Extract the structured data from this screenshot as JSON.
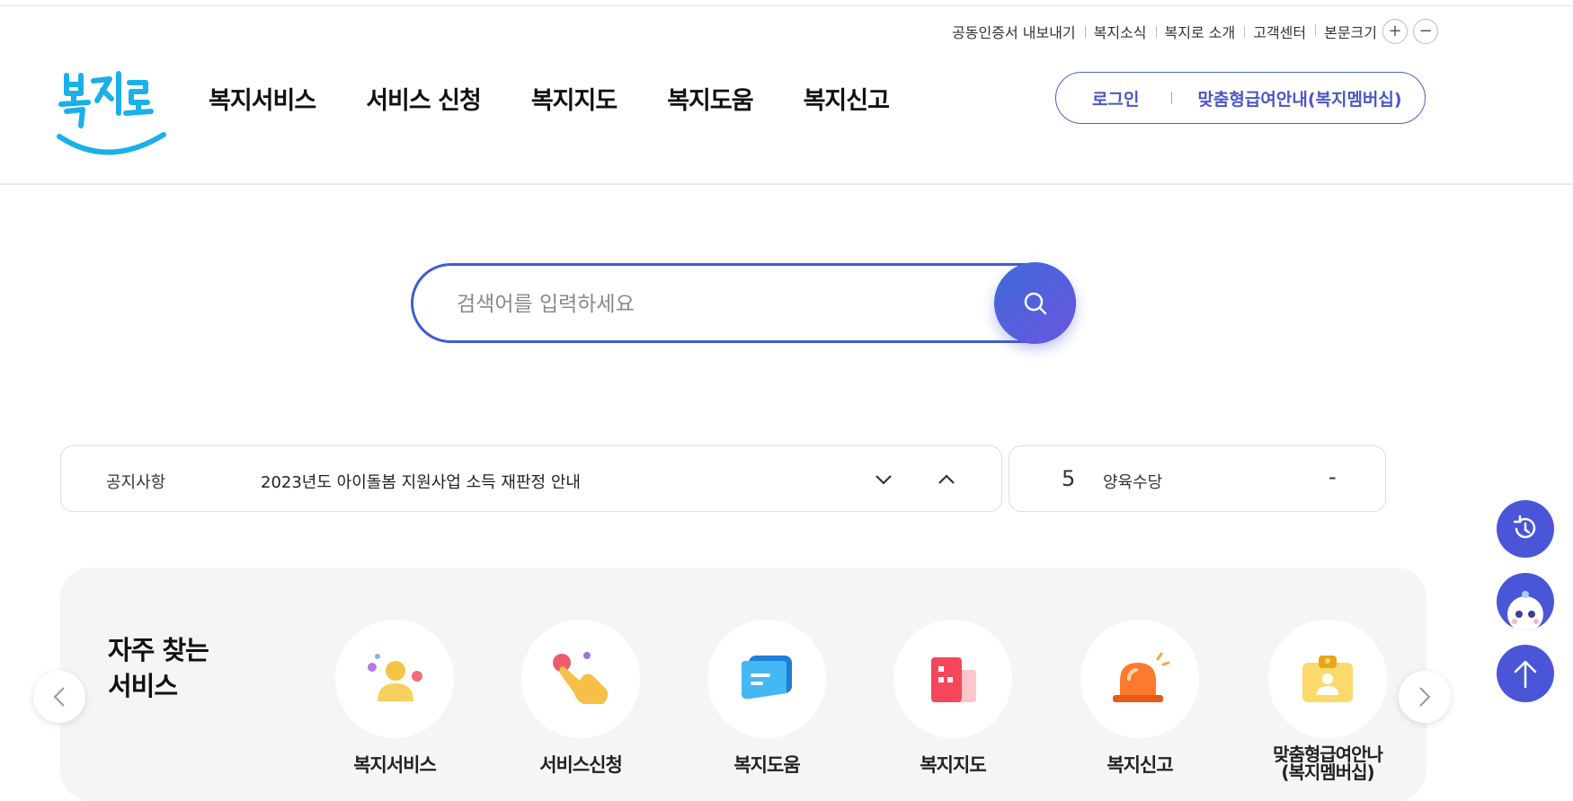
{
  "util_links": [
    "공동인증서 내보내기",
    "복지소식",
    "복지로 소개",
    "고객센터"
  ],
  "text_size": {
    "label": "본문크기",
    "plus": "+",
    "minus": "−"
  },
  "logo": {
    "text": "복지로"
  },
  "gnb": [
    "복지서비스",
    "서비스 신청",
    "복지지도",
    "복지도움",
    "복지신고"
  ],
  "login": {
    "login_label": "로그인",
    "membership_label": "맞춤형급여안내(복지멤버십)"
  },
  "search": {
    "placeholder": "검색어를 입력하세요"
  },
  "notice": {
    "label": "공지사항",
    "text": "2023년도 아이돌봄 지원사업 소득 재판정 안내"
  },
  "ranking": {
    "rank": "5",
    "keyword": "양육수당",
    "change": "-"
  },
  "frequent": {
    "title": "자주 찾는\n서비스",
    "items": [
      {
        "label": "복지서비스",
        "icon": "person-icon"
      },
      {
        "label": "서비스신청",
        "icon": "hand-pointer-icon"
      },
      {
        "label": "복지도움",
        "icon": "chat-icon"
      },
      {
        "label": "복지지도",
        "icon": "building-icon"
      },
      {
        "label": "복지신고",
        "icon": "siren-icon"
      },
      {
        "label": "맞춤형급여안나\n(복지멤버십)",
        "icon": "id-badge-icon"
      }
    ]
  },
  "colors": {
    "brand_blue": "#3d5bd6",
    "logo_cyan": "#1ab0e8",
    "floating": "#4b55d8"
  }
}
